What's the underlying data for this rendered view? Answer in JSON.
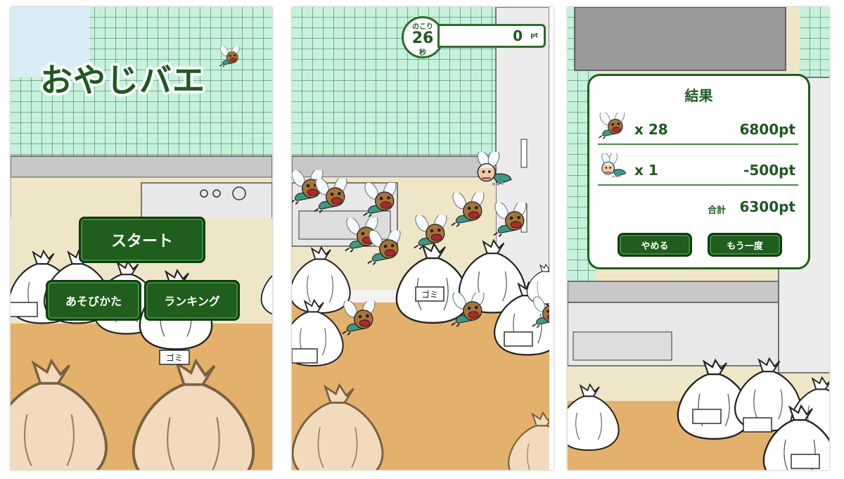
{
  "title_screen": {
    "game_title": "おやじバエ",
    "start_button": "スタート",
    "howto_button": "あそびかた",
    "ranking_button": "ランキング"
  },
  "play_screen": {
    "timer_label_top": "のこり",
    "timer_value": "26",
    "timer_label_bottom": "秒",
    "score_value": "0",
    "score_unit": "pt"
  },
  "result_screen": {
    "heading": "結果",
    "fly_count": "x 28",
    "fly_points": "6800pt",
    "oldman_count": "x  1",
    "oldman_points": "-500pt",
    "total_label": "合計",
    "total_points": "6300pt",
    "quit_button": "やめる",
    "retry_button": "もう一度"
  },
  "bag_label": "ゴミ",
  "colors": {
    "tile": "#bff0d6",
    "grout": "#6a8a7a",
    "floor": "#e3b16b",
    "button": "#1f5e1c"
  },
  "icons": [
    "fly-icon",
    "oldman-icon",
    "trash-bag-icon"
  ]
}
